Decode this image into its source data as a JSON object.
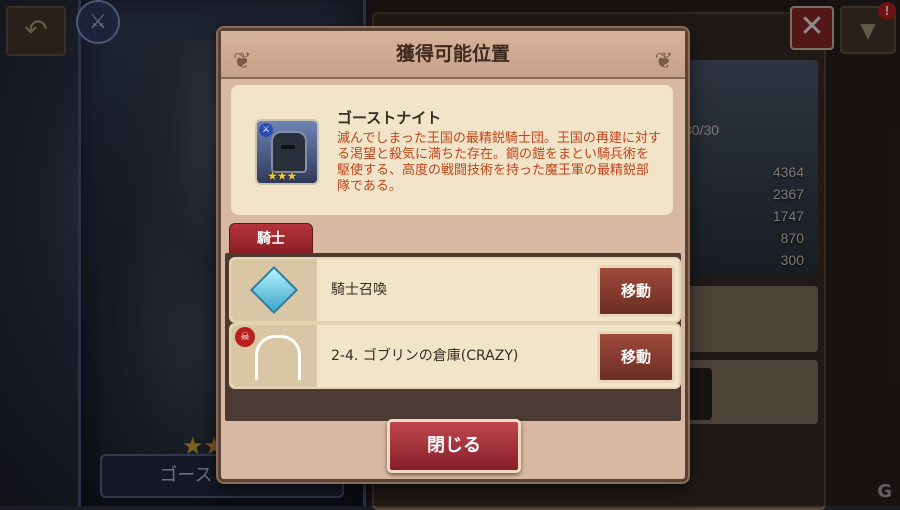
{
  "dialog": {
    "title": "獲得可能位置",
    "character": {
      "name": "ゴーストナイト",
      "description": "滅んでしまった王国の最精鋭騎士団。王国の再建に対する渇望と殺気に満ちた存在。鋼の鎧をまとい騎兵術を駆使する、高度の戦闘技術を持った魔王軍の最精鋭部隊である。",
      "stars": "★★★",
      "class_icon": "sword-icon"
    },
    "tab_label": "騎士",
    "sources": [
      {
        "icon": "diamond-gem-icon",
        "label": "騎士召喚",
        "button": "移動"
      },
      {
        "icon": "gate-laurel-icon",
        "label": "2-4. ゴブリンの倉庫(CRAZY)",
        "button": "移動"
      }
    ],
    "close_button": "閉じる"
  },
  "background": {
    "level_ratio": "30/30",
    "stats": [
      "4364",
      "2367",
      "1747",
      "870",
      "300"
    ],
    "hero_name": "ゴーストナイト",
    "notification_badge": "!"
  },
  "colors": {
    "accent_red": "#9a2a2a",
    "panel_beige": "#f1e4c8",
    "modal_frame": "#d9b8a2",
    "desc_orange": "#c0451d"
  }
}
